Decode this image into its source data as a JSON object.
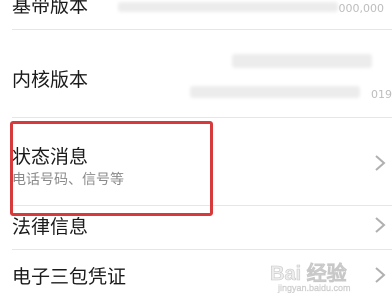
{
  "rows": [
    {
      "label": "基带版本",
      "value_peek": "000,000"
    },
    {
      "label": "内核版本",
      "value_peek": "019"
    },
    {
      "label": "状态消息",
      "sublabel": "电话号码、信号等"
    },
    {
      "label": "法律信息"
    },
    {
      "label": "电子三包凭证"
    }
  ],
  "icons": {
    "chevron": "chevron-right-icon"
  },
  "colors": {
    "highlight": "#d73a3a",
    "divider": "#e6e6e6",
    "sublabel": "#8a8a8a",
    "chevron": "#b0b0b0"
  },
  "watermark": {
    "text": "Bai 经验",
    "subtext": "jingyan.baidu.com"
  }
}
